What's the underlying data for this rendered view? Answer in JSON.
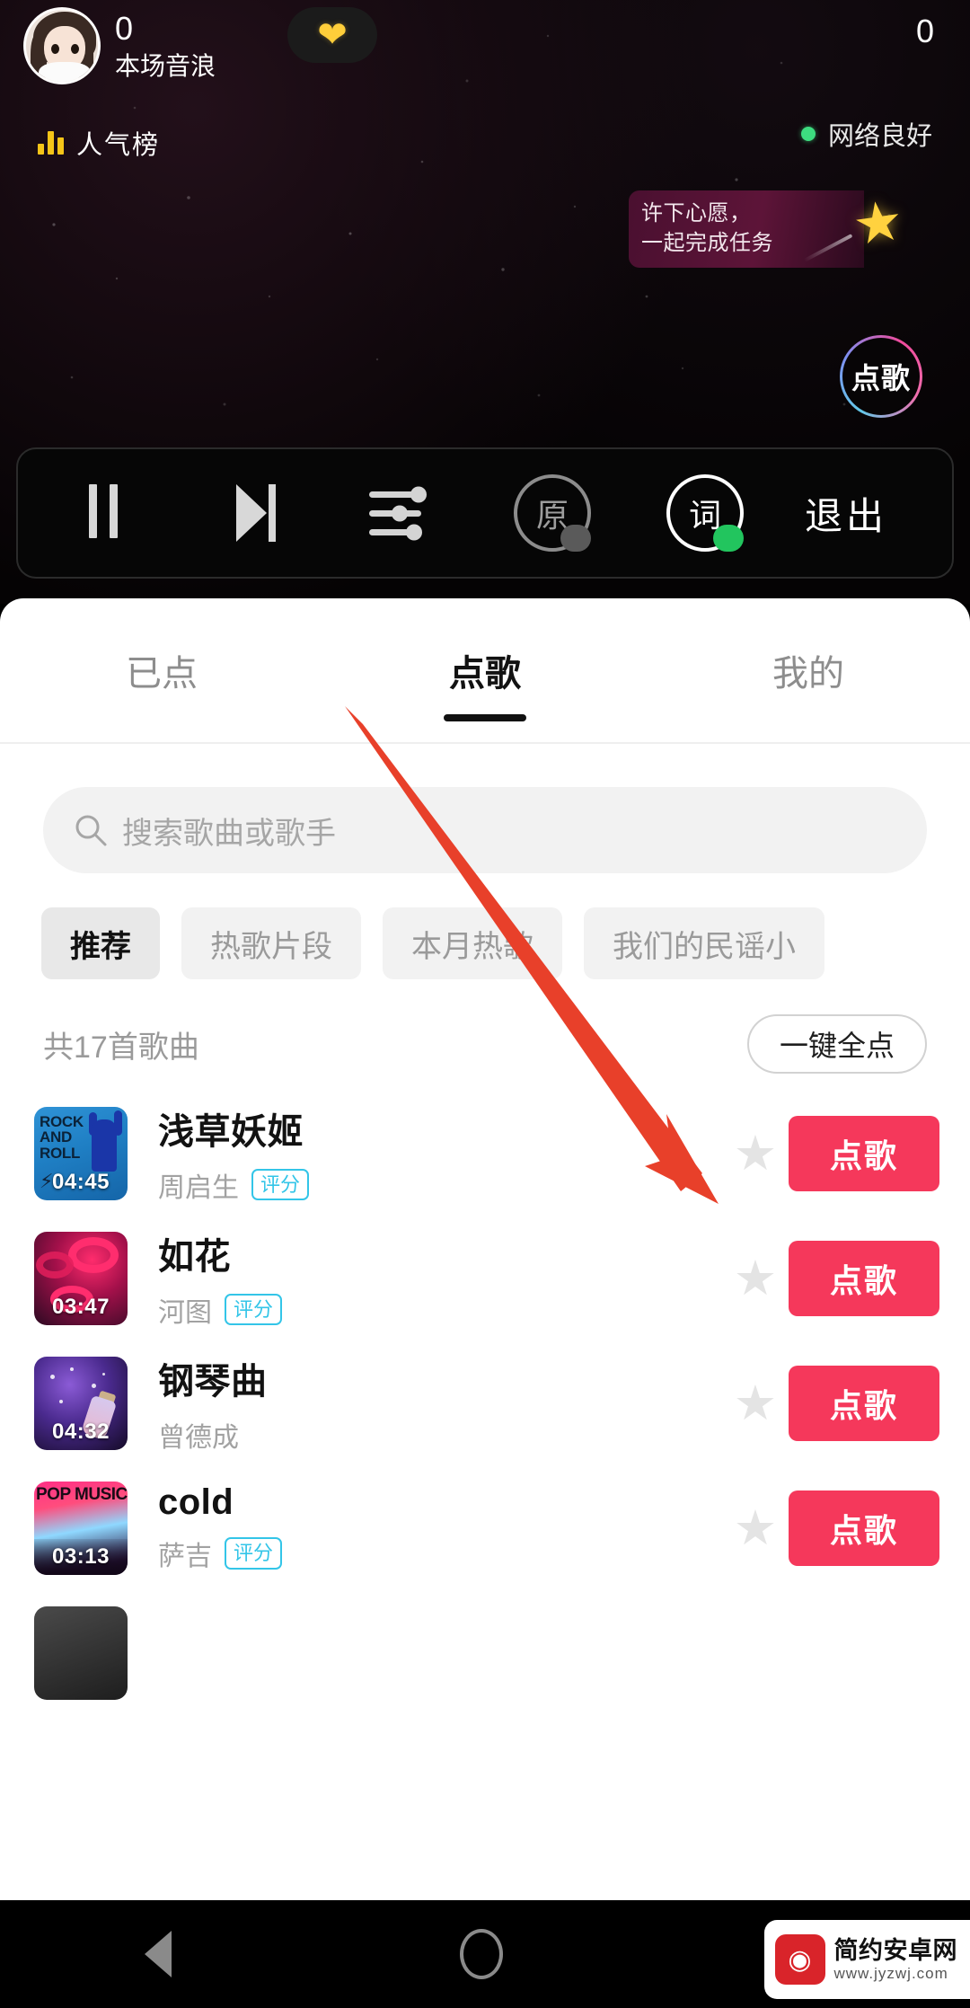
{
  "live": {
    "host": {
      "audio_count": "0",
      "audio_label": "本场音浪",
      "avatar_icon": "avatar"
    },
    "heart_icon": "heart-icon",
    "right_count": "0",
    "ranking": {
      "label": "人气榜",
      "icon": "bar-chart-icon"
    },
    "network": {
      "label": "网络良好",
      "status_color": "#3ddc7f"
    },
    "wish_banner": {
      "line1": "许下心愿，",
      "line2": "一起完成任务",
      "icon": "shooting-star-icon"
    },
    "order_circle": {
      "label": "点歌"
    }
  },
  "player": {
    "pause_label": "pause-icon",
    "next_label": "next-icon",
    "eq_label": "equalizer-icon",
    "original_label": "原",
    "lyric_label": "词",
    "exit_label": "退出",
    "original_toggle": "off",
    "lyric_toggle": "on"
  },
  "sheet": {
    "tabs": [
      {
        "label": "已点",
        "active": false
      },
      {
        "label": "点歌",
        "active": true
      },
      {
        "label": "我的",
        "active": false
      }
    ],
    "search": {
      "placeholder": "搜索歌曲或歌手",
      "value": "",
      "icon": "search-icon"
    },
    "chips": [
      {
        "label": "推荐",
        "active": true
      },
      {
        "label": "热歌片段",
        "active": false
      },
      {
        "label": "本月热歌",
        "active": false
      },
      {
        "label": "我们的民谣小",
        "active": false
      }
    ],
    "count_text": "共17首歌曲",
    "select_all_label": "一键全点",
    "songs": [
      {
        "title": "浅草妖姬",
        "artist": "周启生",
        "score_badge": "评分",
        "duration": "04:45",
        "cover_text": "ROCK AND ROLL",
        "star_state": "off",
        "order_label": "点歌"
      },
      {
        "title": "如花",
        "artist": "河图",
        "score_badge": "评分",
        "duration": "03:47",
        "cover_text": "",
        "star_state": "off",
        "order_label": "点歌"
      },
      {
        "title": "钢琴曲",
        "artist": "曾德成",
        "score_badge": "",
        "duration": "04:32",
        "cover_text": "",
        "star_state": "off",
        "order_label": "点歌"
      },
      {
        "title": "cold",
        "artist": "萨吉",
        "score_badge": "评分",
        "duration": "03:13",
        "cover_text": "POP MUSIC",
        "star_state": "off",
        "order_label": "点歌"
      }
    ]
  },
  "annotation": {
    "arrow_color": "#E8402A"
  },
  "navbar": {
    "back": "back-icon",
    "home": "home-icon",
    "recents": "recents-icon"
  },
  "watermark": {
    "title": "简约安卓网",
    "url": "www.jyzwj.com",
    "badge": "android-icon"
  }
}
